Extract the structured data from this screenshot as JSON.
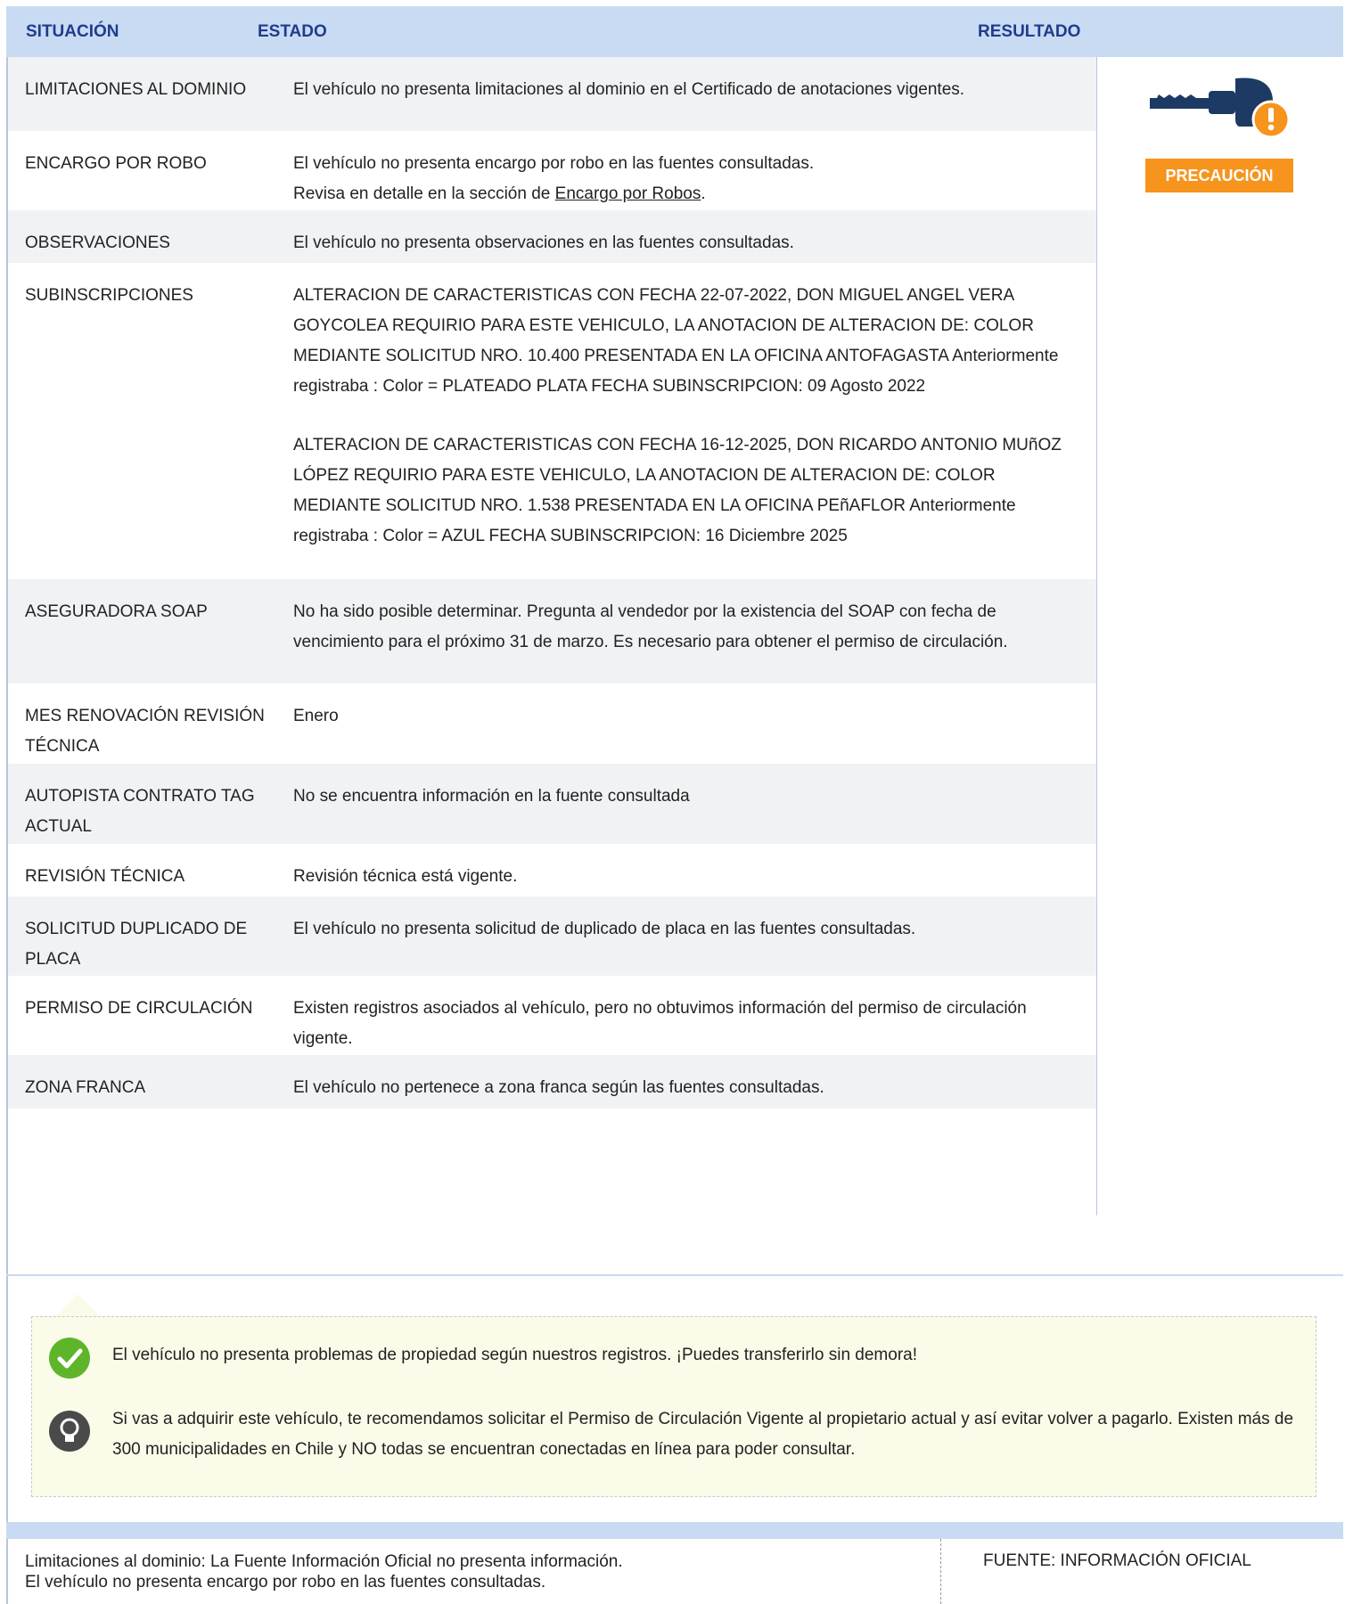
{
  "table": {
    "headers": {
      "situacion": "SITUACIÓN",
      "estado": "ESTADO",
      "resultado": "RESULTADO"
    },
    "rows": [
      {
        "situacion": "LIMITACIONES AL DOMINIO",
        "estado": [
          "El vehículo no presenta limitaciones al dominio en el Certificado de anotaciones vigentes."
        ]
      },
      {
        "situacion": "ENCARGO POR ROBO",
        "estado": [
          "El vehículo no presenta encargo por robo en las fuentes consultadas."
        ],
        "estado_prefix": "Revisa en detalle en la sección de ",
        "estado_link": "Encargo por Robos",
        "estado_suffix": "."
      },
      {
        "situacion": "OBSERVACIONES",
        "estado": [
          "El vehículo no presenta observaciones en las fuentes consultadas."
        ]
      },
      {
        "situacion": "SUBINSCRIPCIONES",
        "estado": [
          "ALTERACION DE CARACTERISTICAS CON FECHA 22-07-2022, DON MIGUEL ANGEL VERA GOYCOLEA REQUIRIO PARA ESTE VEHICULO, LA ANOTACION DE ALTERACION DE: COLOR MEDIANTE SOLICITUD NRO. 10.400 PRESENTADA EN LA OFICINA ANTOFAGASTA Anteriormente registraba : Color = PLATEADO PLATA FECHA SUBINSCRIPCION: 09 Agosto 2022",
          "ALTERACION DE CARACTERISTICAS CON FECHA 16-12-2025, DON RICARDO ANTONIO MUñOZ LÓPEZ REQUIRIO PARA ESTE VEHICULO, LA ANOTACION DE ALTERACION DE: COLOR MEDIANTE SOLICITUD NRO. 1.538 PRESENTADA EN LA OFICINA PEñAFLOR Anteriormente registraba : Color = AZUL FECHA SUBINSCRIPCION: 16 Diciembre 2025"
        ]
      },
      {
        "situacion": "ASEGURADORA SOAP",
        "estado": [
          "No ha sido posible determinar. Pregunta al vendedor por la existencia del SOAP con fecha de vencimiento para el próximo 31 de marzo. Es necesario para obtener el permiso de circulación."
        ]
      },
      {
        "situacion": "MES RENOVACIÓN REVISIÓN TÉCNICA",
        "estado": [
          "Enero"
        ]
      },
      {
        "situacion": "AUTOPISTA CONTRATO TAG ACTUAL",
        "estado": [
          "No se encuentra información en la fuente consultada"
        ]
      },
      {
        "situacion": "REVISIÓN TÉCNICA",
        "estado": [
          "Revisión técnica está vigente."
        ]
      },
      {
        "situacion": "SOLICITUD DUPLICADO DE PLACA",
        "estado": [
          "El vehículo no presenta solicitud de duplicado de placa en las fuentes consultadas."
        ]
      },
      {
        "situacion": "PERMISO DE CIRCULACIÓN",
        "estado": [
          "Existen registros asociados al vehículo, pero no obtuvimos información del permiso de circulación vigente."
        ]
      },
      {
        "situacion": "ZONA FRANCA",
        "estado": [
          "El vehículo no pertenece a zona franca según las fuentes consultadas."
        ]
      }
    ],
    "resultado": {
      "icon": "key-warning-icon",
      "badge": "PRECAUCIÓN",
      "badge_color": "#f7941d"
    }
  },
  "notice": {
    "ok_icon": "check-circle-icon",
    "ok_text": "El vehículo no presenta problemas de propiedad según nuestros registros. ¡Puedes transferirlo sin demora!",
    "tip_icon": "lightbulb-icon",
    "tip_text": "Si vas a adquirir este vehículo, te recomendamos solicitar el Permiso de Circulación Vigente al propietario actual y así evitar volver a pagarlo. Existen más de 300 municipalidades en Chile y NO todas se encuentran conectadas en línea para poder consultar."
  },
  "footer": {
    "line1": "Limitaciones al dominio: La Fuente Información Oficial no presenta información.",
    "line2": "El vehículo no presenta encargo por robo en las fuentes consultadas.",
    "source": "FUENTE: INFORMACIÓN OFICIAL"
  },
  "colors": {
    "header_bg": "#c9dbf3",
    "header_text": "#1f3c8c",
    "row_alt": "#f1f2f4",
    "warning": "#f7941d",
    "ok_green": "#5fb52a",
    "notice_bg": "#fbfbe9"
  }
}
